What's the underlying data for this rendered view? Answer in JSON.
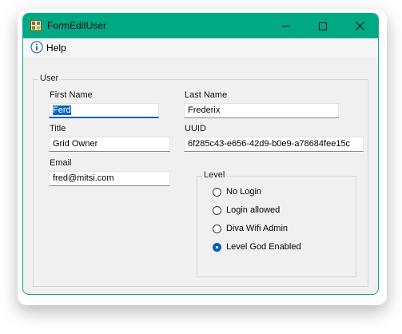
{
  "window": {
    "title": "FormEditUser",
    "titlebar_color": "#00a884",
    "icons": {
      "app": "app-form-icon",
      "minimize": "minimize-icon",
      "maximize": "maximize-icon",
      "close": "close-icon"
    }
  },
  "menu": {
    "help_label": "Help",
    "help_icon": "info-icon"
  },
  "user_group": {
    "title": "User",
    "first_name": {
      "label": "First Name",
      "value": "Ferd"
    },
    "last_name": {
      "label": "Last Name",
      "value": "Frederix"
    },
    "title_field": {
      "label": "Title",
      "value": "Grid Owner"
    },
    "uuid": {
      "label": "UUID",
      "value": "6f285c43-e656-42d9-b0e9-a78684fee15c"
    },
    "email": {
      "label": "Email",
      "value": "fred@mitsi.com"
    }
  },
  "level_group": {
    "title": "Level",
    "options": [
      {
        "label": "No Login",
        "checked": false
      },
      {
        "label": "Login allowed",
        "checked": false
      },
      {
        "label": "Diva Wifi Admin",
        "checked": false
      },
      {
        "label": "Level God Enabled",
        "checked": true
      }
    ],
    "accent_color": "#0a5fb4"
  }
}
